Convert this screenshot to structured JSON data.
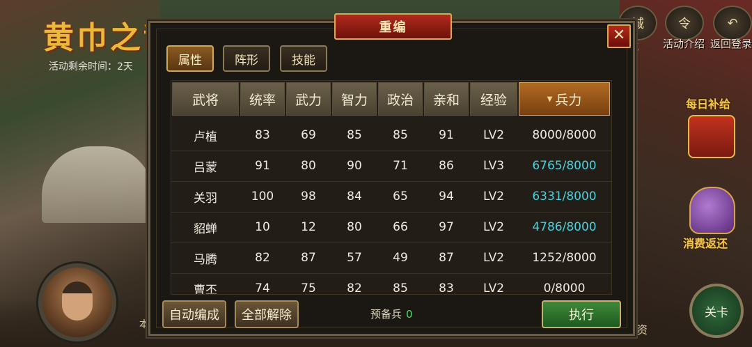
{
  "event": {
    "title": "黄巾之乱",
    "time_label": "活动剩余时间：2天",
    "left_fragment": "本",
    "right_fragment": "物资"
  },
  "top_right": {
    "city_icon": "城",
    "city_label": "城",
    "activity_icon": "令",
    "activity_label": "活动介绍",
    "return_label": "返回登录"
  },
  "side": {
    "daily_supply": "每日补给",
    "spend_rebate": "消费返还",
    "level_button": "关卡"
  },
  "dialog": {
    "title": "重编",
    "close": "✕",
    "tabs": [
      "属性",
      "阵形",
      "技能"
    ],
    "headers": [
      "武将",
      "统率",
      "武力",
      "智力",
      "政治",
      "亲和",
      "经验",
      "兵力"
    ],
    "sorted_column": "兵力",
    "rows": [
      {
        "name": "卢植",
        "lead": "83",
        "force": "69",
        "intel": "85",
        "politics": "85",
        "affinity": "91",
        "exp": "LV2",
        "troops": "8000/8000",
        "low": false
      },
      {
        "name": "吕蒙",
        "lead": "91",
        "force": "80",
        "intel": "90",
        "politics": "71",
        "affinity": "86",
        "exp": "LV3",
        "troops": "6765/8000",
        "low": true
      },
      {
        "name": "关羽",
        "lead": "100",
        "force": "98",
        "intel": "84",
        "politics": "65",
        "affinity": "94",
        "exp": "LV2",
        "troops": "6331/8000",
        "low": true
      },
      {
        "name": "貂蝉",
        "lead": "10",
        "force": "12",
        "intel": "80",
        "politics": "66",
        "affinity": "97",
        "exp": "LV2",
        "troops": "4786/8000",
        "low": true
      },
      {
        "name": "马腾",
        "lead": "82",
        "force": "87",
        "intel": "57",
        "politics": "49",
        "affinity": "87",
        "exp": "LV2",
        "troops": "1252/8000",
        "low": false
      },
      {
        "name": "曹丕",
        "lead": "74",
        "force": "75",
        "intel": "82",
        "politics": "85",
        "affinity": "83",
        "exp": "LV2",
        "troops": "0/8000",
        "low": false
      }
    ],
    "auto_form": "自动编成",
    "release_all": "全部解除",
    "reserve_label": "预备兵",
    "reserve_value": "0",
    "execute": "执行"
  },
  "colors": {
    "troops_low": "#44d4e0",
    "accent_gold": "#d7aa55",
    "title_red": "#b02a1c",
    "execute_green": "#3e8a3a"
  }
}
